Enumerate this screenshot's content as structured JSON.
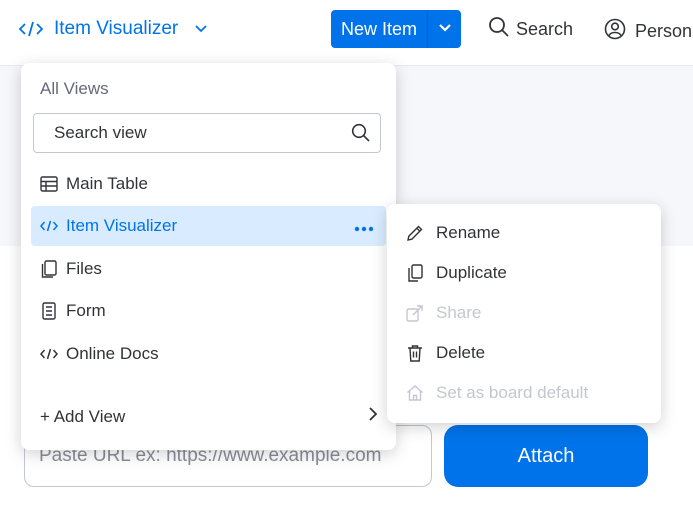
{
  "header": {
    "current_view": "Item Visualizer",
    "new_item_label": "New Item",
    "search_label": "Search",
    "person_label": "Person"
  },
  "views_menu": {
    "heading": "All Views",
    "search_placeholder": "Search view",
    "items": [
      {
        "label": "Main Table",
        "icon": "table-icon"
      },
      {
        "label": "Item Visualizer",
        "icon": "code-icon",
        "selected": true
      },
      {
        "label": "Files",
        "icon": "file-icon"
      },
      {
        "label": "Form",
        "icon": "form-icon"
      },
      {
        "label": "Online Docs",
        "icon": "code-icon"
      }
    ],
    "add_view_label": "+ Add View"
  },
  "context_menu": {
    "items": [
      {
        "label": "Rename",
        "icon": "pencil-icon",
        "enabled": true
      },
      {
        "label": "Duplicate",
        "icon": "duplicate-icon",
        "enabled": true
      },
      {
        "label": "Share",
        "icon": "share-icon",
        "enabled": false
      },
      {
        "label": "Delete",
        "icon": "trash-icon",
        "enabled": true
      },
      {
        "label": "Set as board default",
        "icon": "home-icon",
        "enabled": false
      }
    ]
  },
  "content": {
    "url_placeholder": "Paste URL ex: https://www.example.com",
    "attach_label": "Attach"
  },
  "colors": {
    "primary": "#0073ea",
    "selected_bg": "#d9ecff",
    "text": "#323338",
    "disabled": "#c5c7d0"
  }
}
